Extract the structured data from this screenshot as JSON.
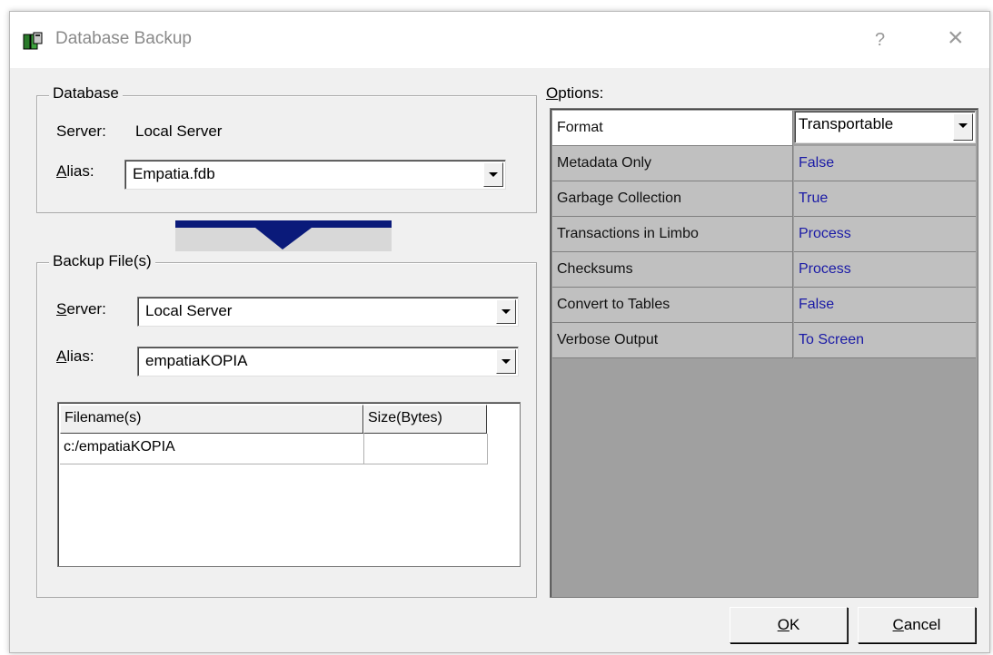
{
  "window": {
    "title": "Database Backup",
    "help": "?",
    "close": "×"
  },
  "database": {
    "legend": "Database",
    "server_label": "Server:",
    "server_value": "Local Server",
    "alias_label_u": "A",
    "alias_label_rest": "lias:",
    "alias_value": "Empatia.fdb"
  },
  "backup": {
    "legend": "Backup File(s)",
    "server_label_u": "S",
    "server_label_rest": "erver:",
    "server_value": "Local Server",
    "alias_label_u": "A",
    "alias_label_rest": "lias:",
    "alias_value": "empatiaKOPIA",
    "columns": [
      "Filename(s)",
      "Size(Bytes)"
    ],
    "rows": [
      [
        "c:/empatiaKOPIA",
        ""
      ]
    ]
  },
  "options": {
    "label_u": "O",
    "label_rest": "ptions:",
    "items": [
      {
        "name": "Format",
        "value": "Transportable"
      },
      {
        "name": "Metadata Only",
        "value": "False"
      },
      {
        "name": "Garbage Collection",
        "value": "True"
      },
      {
        "name": "Transactions in Limbo",
        "value": "Process"
      },
      {
        "name": "Checksums",
        "value": "Process"
      },
      {
        "name": "Convert to Tables",
        "value": "False"
      },
      {
        "name": "Verbose Output",
        "value": "To Screen"
      }
    ]
  },
  "buttons": {
    "ok_u": "O",
    "ok_rest": "K",
    "cancel_u": "C",
    "cancel_rest": "ancel"
  },
  "colors": {
    "option_value": "#1a1aa6",
    "arrow": "#0a1a7a"
  }
}
